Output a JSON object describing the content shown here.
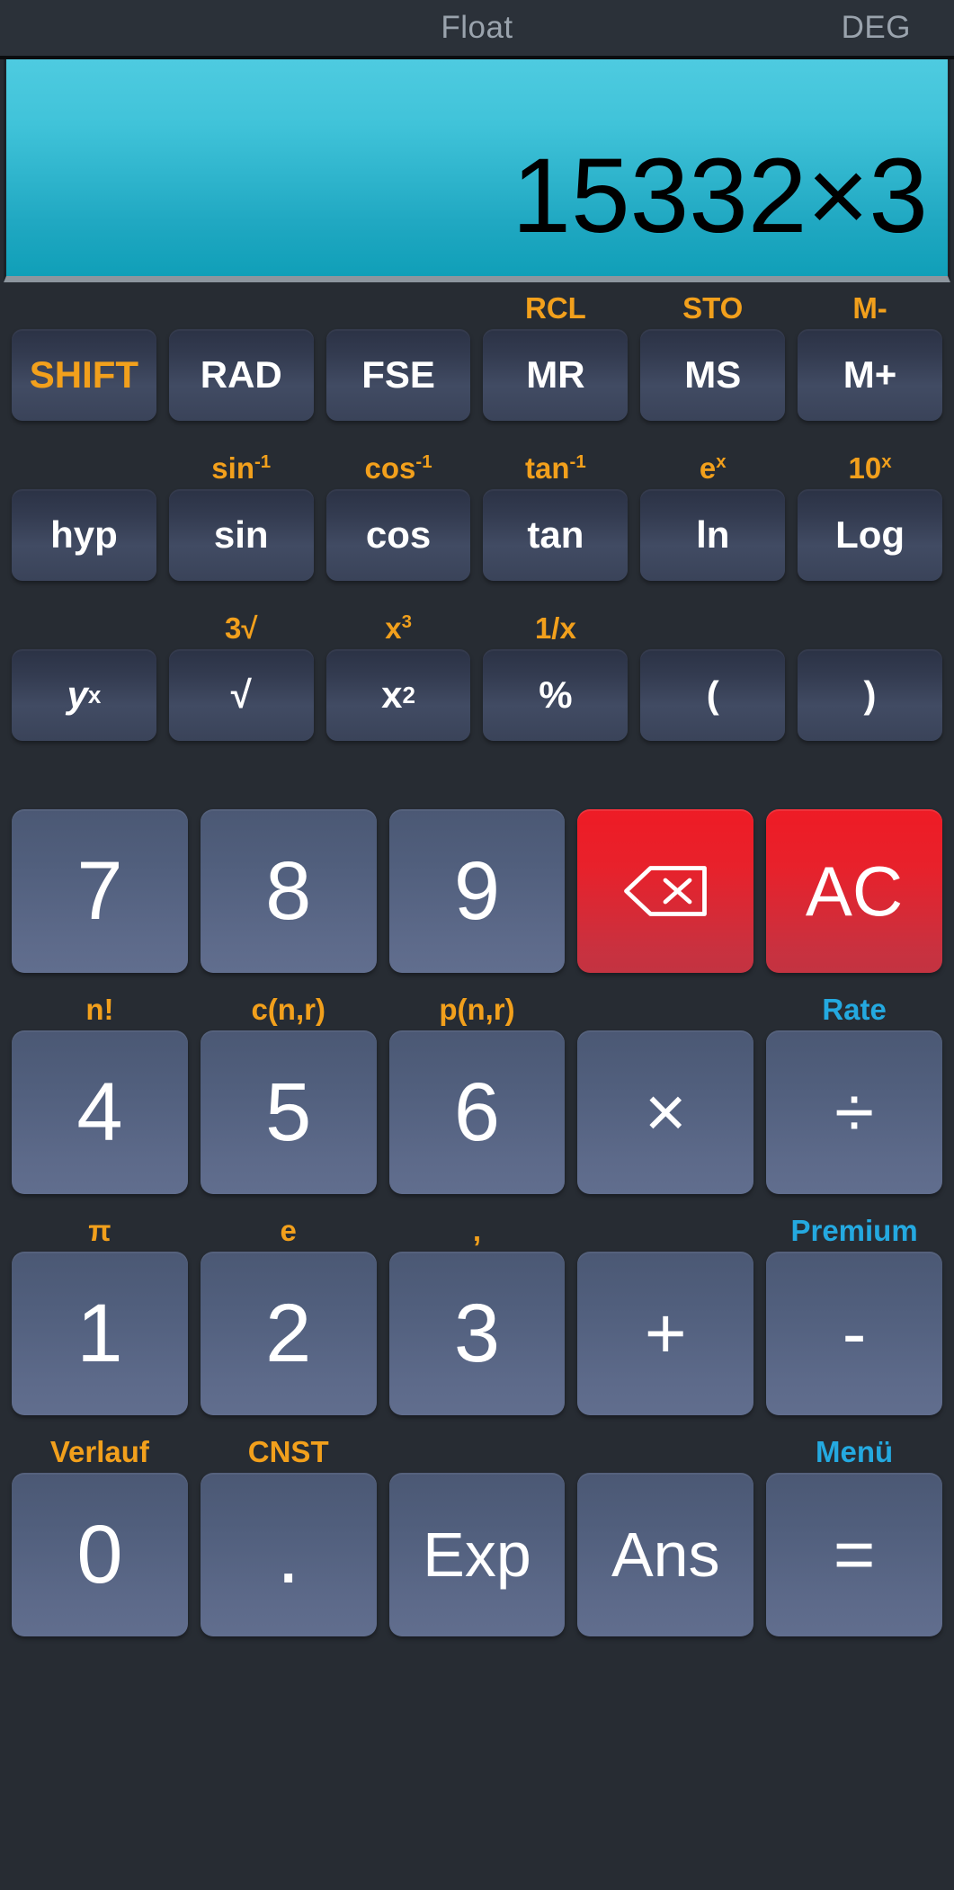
{
  "statusbar": {
    "number_format": "Float",
    "angle_mode": "DEG"
  },
  "display": {
    "expression": "15332×3"
  },
  "colors": {
    "background": "#272c33",
    "display_top": "#4ecbe0",
    "display_bottom": "#109fb8",
    "shift_orange": "#f2a01c",
    "shift_blue": "#24a9e0",
    "fn_key": "#3a4359",
    "num_key": "#5b6787",
    "red_key": "#e8212b",
    "key_text": "#ffffff"
  },
  "keypad": {
    "rows": [
      {
        "name": "row-memory",
        "keys": [
          {
            "name": "shift",
            "shift": "",
            "label": "SHIFT",
            "style": "fn shiftkey"
          },
          {
            "name": "rad",
            "shift": "",
            "label": "RAD",
            "style": "fn"
          },
          {
            "name": "fse",
            "shift": "",
            "label": "FSE",
            "style": "fn"
          },
          {
            "name": "mr",
            "shift": "RCL",
            "label": "MR",
            "style": "fn"
          },
          {
            "name": "ms",
            "shift": "STO",
            "label": "MS",
            "style": "fn"
          },
          {
            "name": "m-plus",
            "shift": "M-",
            "label": "M+",
            "style": "fn"
          }
        ]
      },
      {
        "name": "row-trig",
        "keys": [
          {
            "name": "hyp",
            "shift": "",
            "shift_sup": "",
            "label": "hyp",
            "style": "fn"
          },
          {
            "name": "sin",
            "shift": "sin",
            "shift_sup": "-1",
            "label": "sin",
            "style": "fn"
          },
          {
            "name": "cos",
            "shift": "cos",
            "shift_sup": "-1",
            "label": "cos",
            "style": "fn"
          },
          {
            "name": "tan",
            "shift": "tan",
            "shift_sup": "-1",
            "label": "tan",
            "style": "fn"
          },
          {
            "name": "ln",
            "shift": "e",
            "shift_sup": "x",
            "label": "ln",
            "style": "fn"
          },
          {
            "name": "log",
            "shift": "10",
            "shift_sup": "x",
            "label": "Log",
            "style": "fn"
          }
        ]
      },
      {
        "name": "row-power",
        "keys": [
          {
            "name": "y-power-x",
            "shift": "",
            "shift_sup": "",
            "label": "y",
            "label_sup": "x",
            "style": "fn"
          },
          {
            "name": "square-root",
            "shift": "3√",
            "shift_sup": "",
            "label": "√",
            "style": "fn"
          },
          {
            "name": "x-squared",
            "shift": "x",
            "shift_sup": "3",
            "label": "x",
            "label_sup": "2",
            "style": "fn"
          },
          {
            "name": "percent",
            "shift": "1/x",
            "shift_sup": "",
            "label": "%",
            "style": "fn"
          },
          {
            "name": "paren-open",
            "shift": "",
            "shift_sup": "",
            "label": "(",
            "style": "fn"
          },
          {
            "name": "paren-close",
            "shift": "",
            "shift_sup": "",
            "label": ")",
            "style": "fn"
          }
        ]
      },
      {
        "name": "row-789",
        "keys": [
          {
            "name": "digit-7",
            "shift": "",
            "label": "7",
            "style": "num"
          },
          {
            "name": "digit-8",
            "shift": "",
            "label": "8",
            "style": "num"
          },
          {
            "name": "digit-9",
            "shift": "",
            "label": "9",
            "style": "num"
          },
          {
            "name": "backspace",
            "shift": "",
            "label": "",
            "style": "red",
            "icon": "backspace-icon"
          },
          {
            "name": "all-clear",
            "shift": "",
            "label": "AC",
            "style": "red"
          }
        ]
      },
      {
        "name": "row-456",
        "keys": [
          {
            "name": "digit-4",
            "shift": "n!",
            "label": "4",
            "style": "num"
          },
          {
            "name": "digit-5",
            "shift": "c(n,r)",
            "label": "5",
            "style": "num"
          },
          {
            "name": "digit-6",
            "shift": "p(n,r)",
            "label": "6",
            "style": "num"
          },
          {
            "name": "multiply",
            "shift": "",
            "label": "×",
            "style": "num op"
          },
          {
            "name": "divide",
            "shift": "Rate",
            "shift_color": "blue",
            "label": "÷",
            "style": "num op"
          }
        ]
      },
      {
        "name": "row-123",
        "keys": [
          {
            "name": "digit-1",
            "shift": "π",
            "label": "1",
            "style": "num"
          },
          {
            "name": "digit-2",
            "shift": "e",
            "label": "2",
            "style": "num"
          },
          {
            "name": "digit-3",
            "shift": ",",
            "label": "3",
            "style": "num"
          },
          {
            "name": "plus",
            "shift": "",
            "label": "+",
            "style": "num op"
          },
          {
            "name": "minus",
            "shift": "Premium",
            "shift_color": "blue",
            "label": "-",
            "style": "num op"
          }
        ]
      },
      {
        "name": "row-zero",
        "keys": [
          {
            "name": "digit-0",
            "shift": "Verlauf",
            "label": "0",
            "style": "num"
          },
          {
            "name": "decimal-point",
            "shift": "CNST",
            "label": ".",
            "style": "num"
          },
          {
            "name": "exponent",
            "shift": "",
            "label": "Exp",
            "style": "num word"
          },
          {
            "name": "answer",
            "shift": "",
            "label": "Ans",
            "style": "num word"
          },
          {
            "name": "equals",
            "shift": "Menü",
            "shift_color": "blue",
            "label": "=",
            "style": "num op"
          }
        ]
      }
    ]
  }
}
